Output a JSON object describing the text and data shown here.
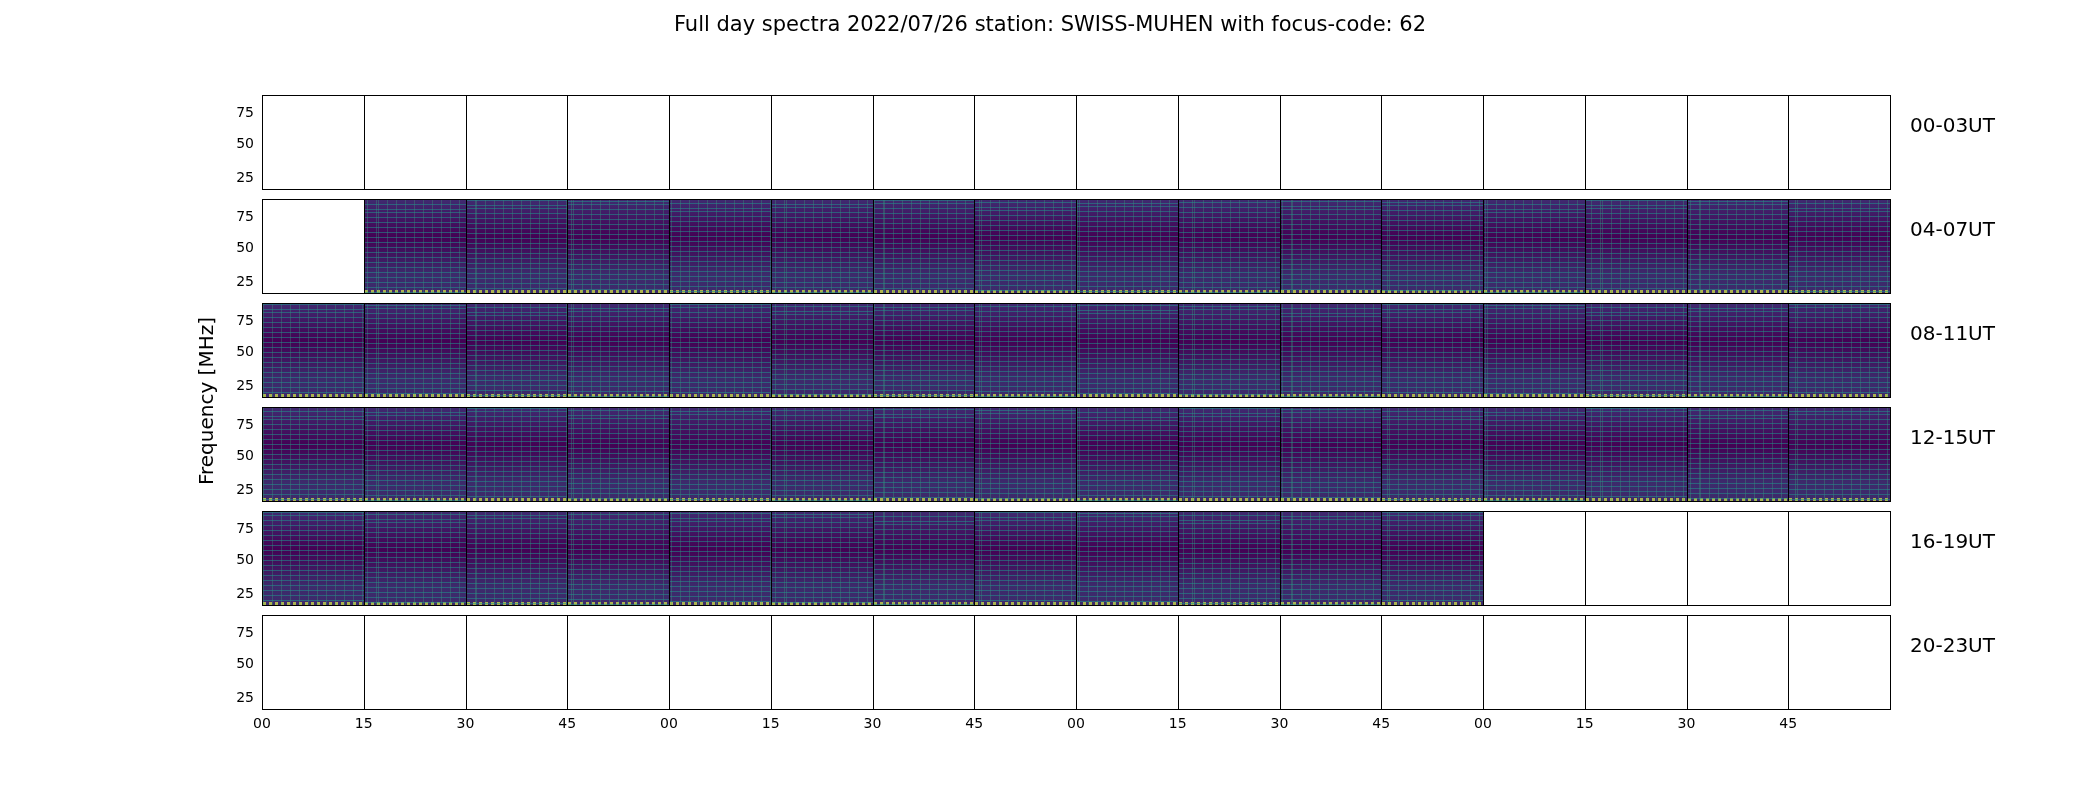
{
  "title": "Full day spectra 2022/07/26 station: SWISS-MUHEN with focus-code: 62",
  "ylabel": "Frequency [MHz]",
  "rows": [
    {
      "label": "00-03UT",
      "yticks": [
        "75",
        "50",
        "25"
      ],
      "panels": [
        {
          "filled": false
        },
        {
          "filled": false
        },
        {
          "filled": false
        },
        {
          "filled": false
        },
        {
          "filled": false
        },
        {
          "filled": false
        },
        {
          "filled": false
        },
        {
          "filled": false
        },
        {
          "filled": false
        },
        {
          "filled": false
        },
        {
          "filled": false
        },
        {
          "filled": false
        },
        {
          "filled": false
        },
        {
          "filled": false
        },
        {
          "filled": false
        },
        {
          "filled": false
        }
      ]
    },
    {
      "label": "04-07UT",
      "yticks": [
        "75",
        "50",
        "25"
      ],
      "panels": [
        {
          "filled": false
        },
        {
          "filled": true
        },
        {
          "filled": true
        },
        {
          "filled": true
        },
        {
          "filled": true
        },
        {
          "filled": true
        },
        {
          "filled": true
        },
        {
          "filled": true
        },
        {
          "filled": true
        },
        {
          "filled": true
        },
        {
          "filled": true
        },
        {
          "filled": true
        },
        {
          "filled": true
        },
        {
          "filled": true
        },
        {
          "filled": true
        },
        {
          "filled": true
        }
      ]
    },
    {
      "label": "08-11UT",
      "yticks": [
        "75",
        "50",
        "25"
      ],
      "panels": [
        {
          "filled": true
        },
        {
          "filled": true
        },
        {
          "filled": true
        },
        {
          "filled": true
        },
        {
          "filled": true
        },
        {
          "filled": true
        },
        {
          "filled": true
        },
        {
          "filled": true
        },
        {
          "filled": true
        },
        {
          "filled": true
        },
        {
          "filled": true
        },
        {
          "filled": true
        },
        {
          "filled": true
        },
        {
          "filled": true
        },
        {
          "filled": true
        },
        {
          "filled": true
        }
      ]
    },
    {
      "label": "12-15UT",
      "yticks": [
        "75",
        "50",
        "25"
      ],
      "panels": [
        {
          "filled": true
        },
        {
          "filled": true
        },
        {
          "filled": true
        },
        {
          "filled": true
        },
        {
          "filled": true
        },
        {
          "filled": true
        },
        {
          "filled": true
        },
        {
          "filled": true
        },
        {
          "filled": true
        },
        {
          "filled": true
        },
        {
          "filled": true
        },
        {
          "filled": true
        },
        {
          "filled": true
        },
        {
          "filled": true
        },
        {
          "filled": true
        },
        {
          "filled": true
        }
      ]
    },
    {
      "label": "16-19UT",
      "yticks": [
        "75",
        "50",
        "25"
      ],
      "panels": [
        {
          "filled": true
        },
        {
          "filled": true
        },
        {
          "filled": true
        },
        {
          "filled": true
        },
        {
          "filled": true
        },
        {
          "filled": true
        },
        {
          "filled": true
        },
        {
          "filled": true
        },
        {
          "filled": true
        },
        {
          "filled": true
        },
        {
          "filled": true
        },
        {
          "filled": true
        },
        {
          "filled": false
        },
        {
          "filled": false
        },
        {
          "filled": false
        },
        {
          "filled": false
        }
      ]
    },
    {
      "label": "20-23UT",
      "yticks": [
        "75",
        "50",
        "25"
      ],
      "panels": [
        {
          "filled": false
        },
        {
          "filled": false
        },
        {
          "filled": false
        },
        {
          "filled": false
        },
        {
          "filled": false
        },
        {
          "filled": false
        },
        {
          "filled": false
        },
        {
          "filled": false
        },
        {
          "filled": false
        },
        {
          "filled": false
        },
        {
          "filled": false
        },
        {
          "filled": false
        },
        {
          "filled": false
        },
        {
          "filled": false
        },
        {
          "filled": false
        },
        {
          "filled": false
        }
      ]
    }
  ],
  "xticks": [
    "00",
    "15",
    "30",
    "45",
    "00",
    "15",
    "30",
    "45",
    "00",
    "15",
    "30",
    "45",
    "00",
    "15",
    "30",
    "45"
  ]
}
